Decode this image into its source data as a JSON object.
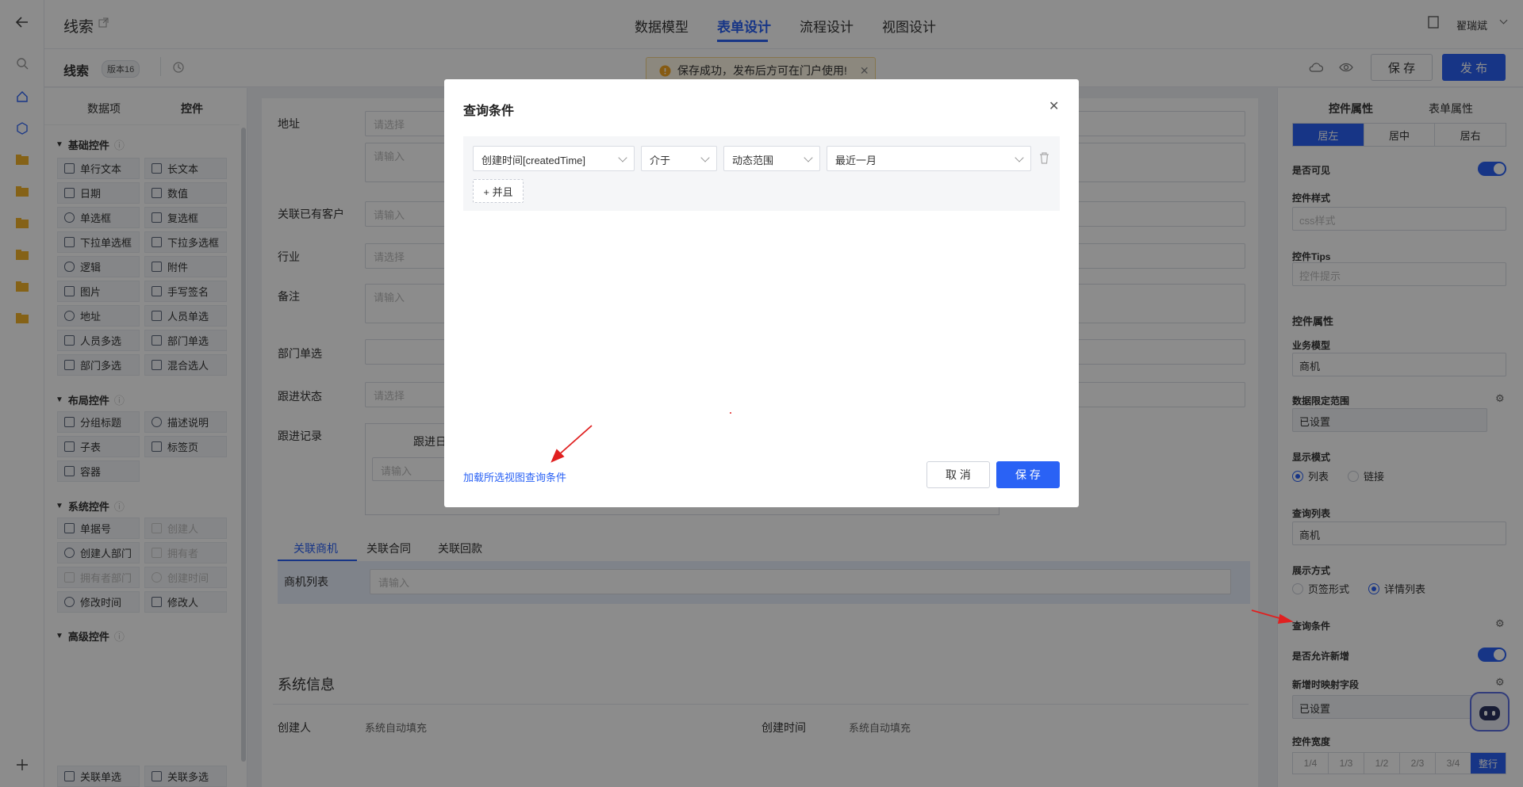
{
  "header": {
    "back_icon": "arrow-left-icon",
    "title": "线索",
    "tabs": [
      "数据模型",
      "表单设计",
      "流程设计",
      "视图设计"
    ],
    "active_tab": 1,
    "user": "翟瑞斌"
  },
  "toolbar": {
    "form_name": "线索",
    "version": "版本16",
    "save_label": "保 存",
    "publish_label": "发 布"
  },
  "toast": {
    "text": "保存成功，发布后方可在门户使用!"
  },
  "left_panel": {
    "tabs": [
      "数据项",
      "控件"
    ],
    "sections": [
      {
        "title": "基础控件",
        "items": [
          "单行文本",
          "长文本",
          "日期",
          "数值",
          "单选框",
          "复选框",
          "下拉单选框",
          "下拉多选框",
          "逻辑",
          "附件",
          "图片",
          "手写签名",
          "地址",
          "人员单选",
          "人员多选",
          "部门单选",
          "部门多选",
          "混合选人"
        ]
      },
      {
        "title": "布局控件",
        "items": [
          "分组标题",
          "描述说明",
          "子表",
          "标签页",
          "容器"
        ]
      },
      {
        "title": "系统控件",
        "items": [
          "单据号",
          "创建人",
          "创建人部门",
          "拥有者",
          "拥有者部门",
          "创建时间",
          "修改时间",
          "修改人"
        ]
      },
      {
        "title": "高级控件",
        "items": [
          "关联单选",
          "关联多选"
        ]
      }
    ]
  },
  "canvas": {
    "fields": [
      {
        "label": "地址",
        "placeholder": "请选择",
        "placeholder2": "请输入"
      },
      {
        "label": "关联已有客户",
        "placeholder": "请输入"
      },
      {
        "label": "行业",
        "placeholder": "请选择"
      },
      {
        "label": "备注",
        "placeholder": "请输入"
      },
      {
        "label": "部门单选",
        "placeholder": ""
      },
      {
        "label": "跟进状态",
        "placeholder": "请选择"
      },
      {
        "label": "跟进记录",
        "col": "跟进日",
        "placeholder": "请输入"
      }
    ],
    "tabs": [
      "关联商机",
      "关联合同",
      "关联回款"
    ],
    "list_label": "商机列表",
    "list_placeholder": "请输入",
    "system_title": "系统信息",
    "creator_label": "创建人",
    "creator_value": "系统自动填充",
    "created_label": "创建时间",
    "created_value": "系统自动填充"
  },
  "right_panel": {
    "tabs": [
      "控件属性",
      "表单属性"
    ],
    "align": [
      "居左",
      "居中",
      "居右"
    ],
    "visible_label": "是否可见",
    "style_label": "控件样式",
    "style_placeholder": "css样式",
    "tips_label": "控件Tips",
    "tips_placeholder": "控件提示",
    "props_title": "控件属性",
    "model_label": "业务模型",
    "model_value": "商机",
    "range_label": "数据限定范围",
    "range_value": "已设置",
    "display_label": "显示模式",
    "display_options": [
      "列表",
      "链接"
    ],
    "query_list_label": "查询列表",
    "query_list_value": "商机",
    "show_label": "展示方式",
    "show_options": [
      "页签形式",
      "详情列表"
    ],
    "query_cond_label": "查询条件",
    "allow_add_label": "是否允许新增",
    "mapping_label": "新增时映射字段",
    "mapping_value": "已设置",
    "width_label": "控件宽度",
    "width_options": [
      "1/4",
      "1/3",
      "1/2",
      "2/3",
      "3/4",
      "整行"
    ]
  },
  "modal": {
    "title": "查询条件",
    "field": "创建时间[createdTime]",
    "operator": "介于",
    "range_type": "动态范围",
    "range_value": "最近一月",
    "and_label": "+ 并且",
    "load_link": "加载所选视图查询条件",
    "cancel_label": "取 消",
    "save_label": "保 存"
  },
  "colors": {
    "primary": "#2a62f5",
    "annotation": "#e02020"
  }
}
